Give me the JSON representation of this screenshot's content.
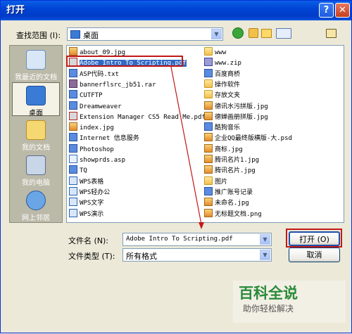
{
  "title": "打开",
  "title_buttons": {
    "help": "?",
    "close": "✕"
  },
  "lookin": {
    "label": "查找范围 (I):",
    "value": "桌面"
  },
  "places": [
    {
      "label": "我最近的文档",
      "icon": "recent-docs-icon"
    },
    {
      "label": "桌面",
      "icon": "desktop-icon",
      "selected": true
    },
    {
      "label": "我的文档",
      "icon": "my-documents-icon"
    },
    {
      "label": "我的电脑",
      "icon": "my-computer-icon"
    },
    {
      "label": "网上邻居",
      "icon": "network-places-icon"
    }
  ],
  "files_col1": [
    {
      "name": "about_09.jpg",
      "icon": "image-file-icon"
    },
    {
      "name": "Adobe Intro To Scripting.pdf",
      "icon": "pdf-file-icon",
      "selected": true
    },
    {
      "name": "ASP代码.txt",
      "icon": "exe-file-icon"
    },
    {
      "name": "bannerflsrc_jb51.rar",
      "icon": "rar-file-icon"
    },
    {
      "name": "CUTFTP",
      "icon": "exe-file-icon"
    },
    {
      "name": "Dreamweaver",
      "icon": "exe-file-icon"
    },
    {
      "name": "Extension Manager CS5 Read Me.pdf",
      "icon": "pdf-file-icon"
    },
    {
      "name": "index.jpg",
      "icon": "image-file-icon"
    },
    {
      "name": "Internet 信息服务",
      "icon": "exe-file-icon"
    },
    {
      "name": "Photoshop",
      "icon": "exe-file-icon"
    },
    {
      "name": "showprds.asp",
      "icon": "html-file-icon"
    },
    {
      "name": "TQ",
      "icon": "exe-file-icon"
    },
    {
      "name": "WPS表格",
      "icon": "wps-file-icon"
    },
    {
      "name": "WPS轻办公",
      "icon": "wps-file-icon"
    },
    {
      "name": "WPS文字",
      "icon": "wps-file-icon"
    },
    {
      "name": "WPS演示",
      "icon": "wps-file-icon"
    }
  ],
  "files_col2": [
    {
      "name": "www",
      "icon": "folder-icon"
    },
    {
      "name": "www.zip",
      "icon": "zip-file-icon"
    },
    {
      "name": "百度商桥",
      "icon": "exe-file-icon"
    },
    {
      "name": "操作软件",
      "icon": "folder-icon"
    },
    {
      "name": "存放文夹",
      "icon": "folder-icon"
    },
    {
      "name": "德讯水污拼版.jpg",
      "icon": "image-file-icon"
    },
    {
      "name": "德婵画册拼版.jpg",
      "icon": "image-file-icon"
    },
    {
      "name": "酷狗音乐",
      "icon": "exe-file-icon"
    },
    {
      "name": "企业QQ最终版横版-大.psd",
      "icon": "image-file-icon"
    },
    {
      "name": "商标.jpg",
      "icon": "image-file-icon"
    },
    {
      "name": "腾讯名片1.jpg",
      "icon": "image-file-icon"
    },
    {
      "name": "腾讯名片.jpg",
      "icon": "image-file-icon"
    },
    {
      "name": "图片",
      "icon": "folder-icon"
    },
    {
      "name": "推广账号记录",
      "icon": "exe-file-icon"
    },
    {
      "name": "未命名.jpg",
      "icon": "image-file-icon"
    },
    {
      "name": "无标题文档.png",
      "icon": "image-file-icon"
    }
  ],
  "filename": {
    "label": "文件名 (N):",
    "value": "Adobe Intro To Scripting.pdf"
  },
  "filetype": {
    "label": "文件类型 (T):",
    "value": "所有格式"
  },
  "open_button": "打开 (O)",
  "cancel_button": "取消",
  "watermark": {
    "title": "百科全说",
    "subtitle": "助你轻松解决"
  },
  "accent_colors": {
    "titlebar": "#0a5fe6",
    "highlight": "#316ac5",
    "annotation": "#c01919"
  }
}
